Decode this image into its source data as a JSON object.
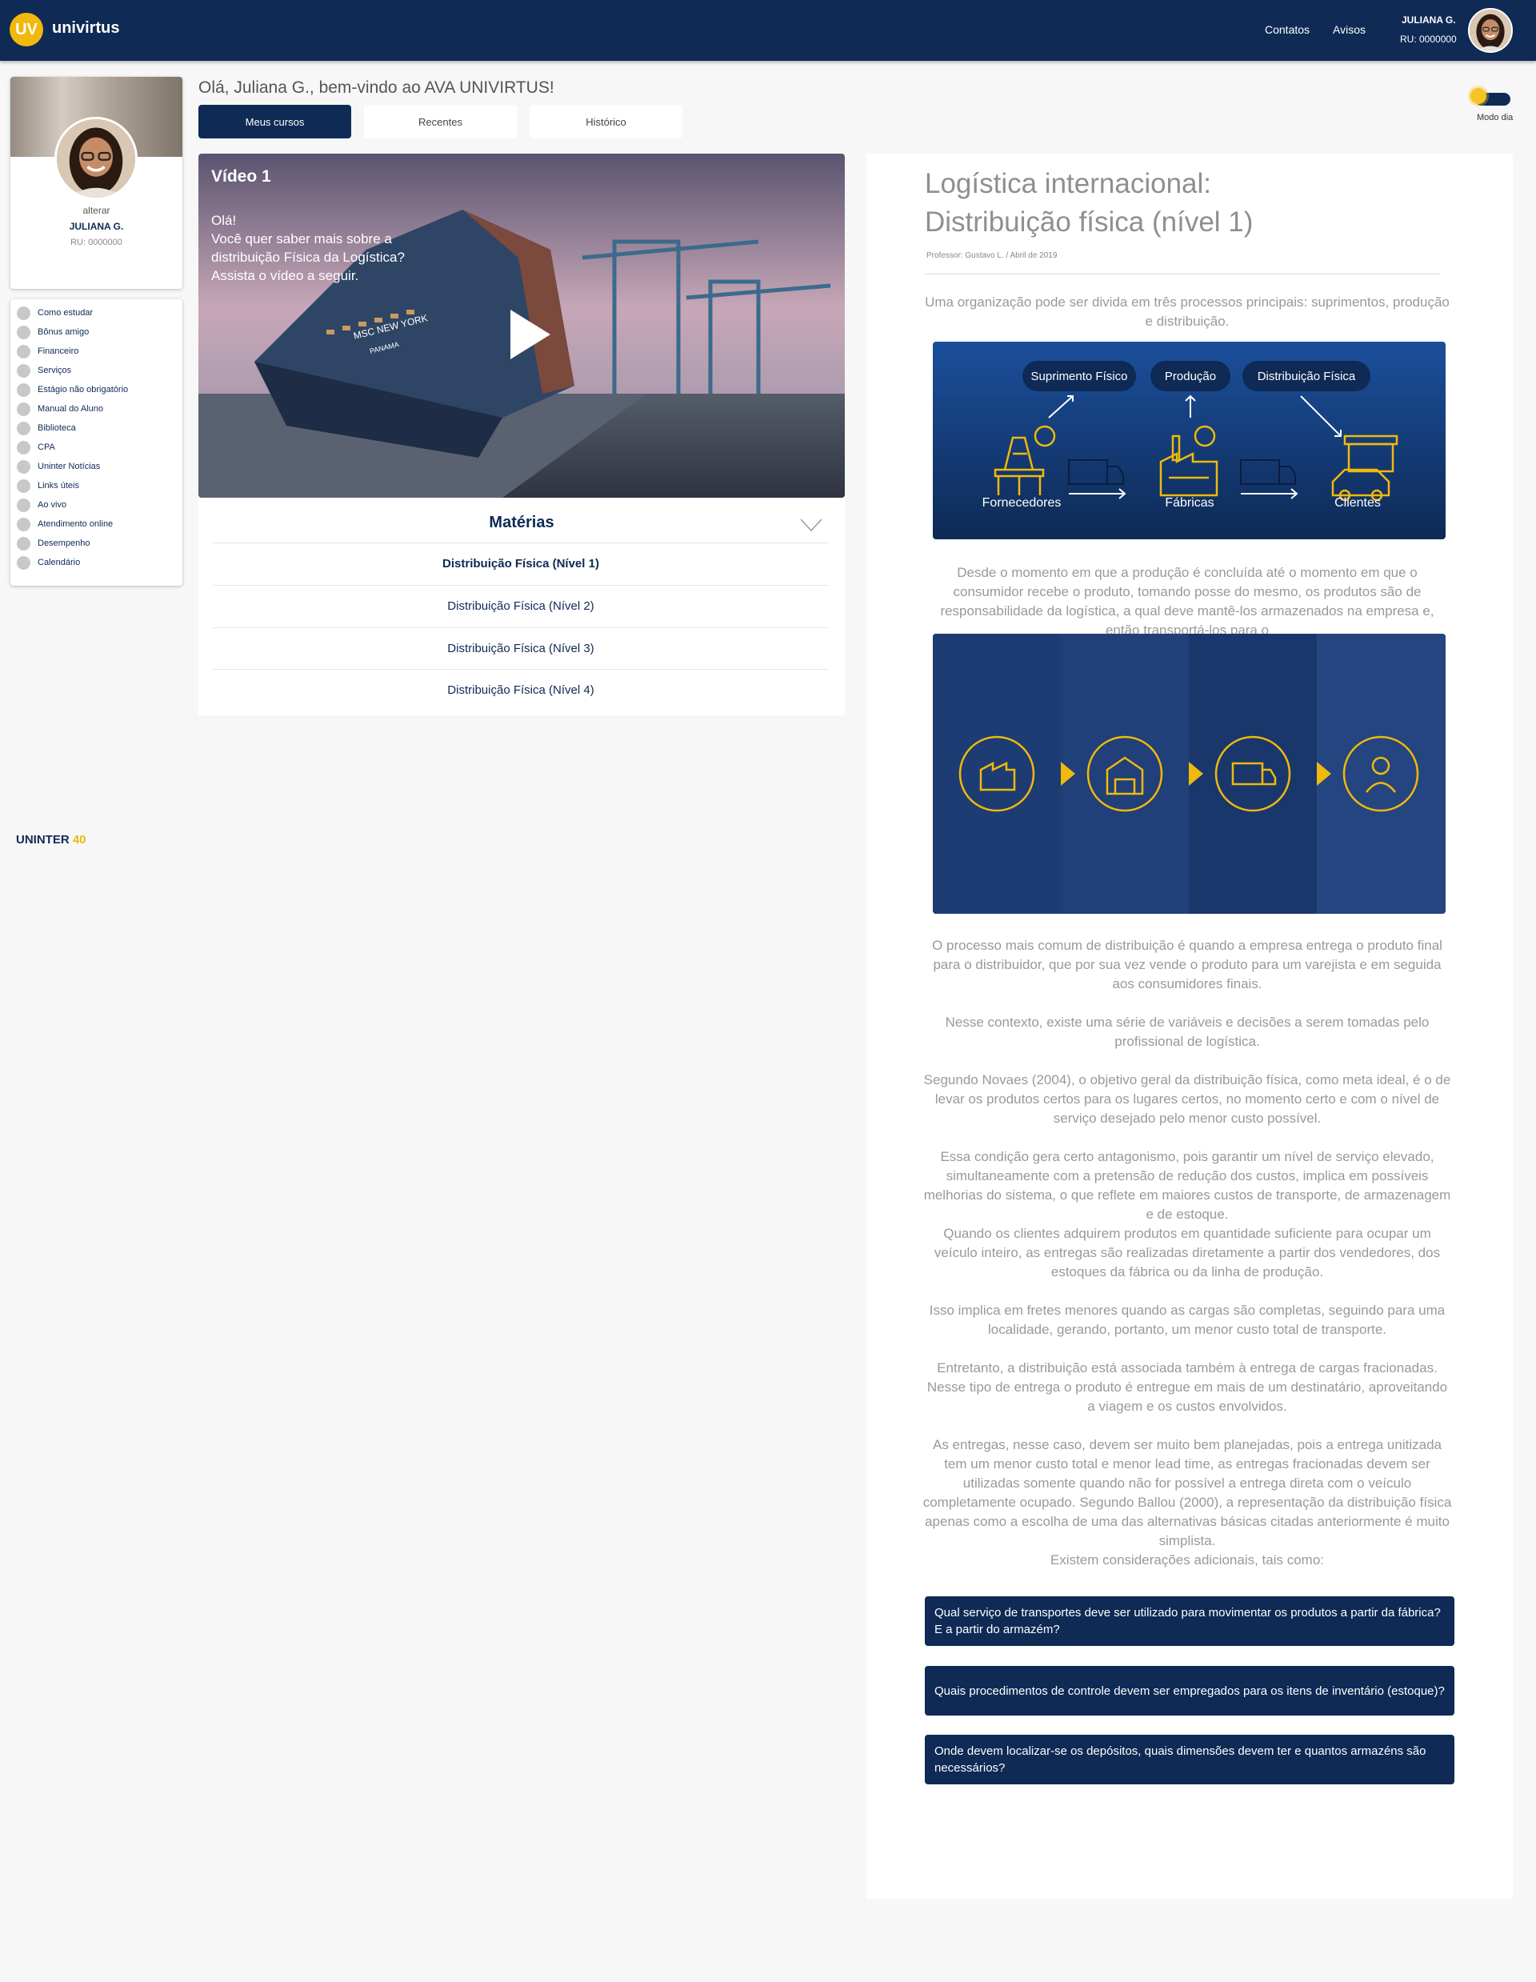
{
  "header": {
    "logo_mark": "UV",
    "logo_text": "univirtus",
    "nav": [
      "Contatos",
      "Avisos"
    ],
    "user_name": "JULIANA G.",
    "user_ru": "RU: 0000000"
  },
  "profile": {
    "alter_label": "alterar",
    "name": "JULIANA G.",
    "ru": "RU: 0000000"
  },
  "sidebar": {
    "items": [
      {
        "label": "Como estudar"
      },
      {
        "label": "Bônus amigo"
      },
      {
        "label": "Financeiro"
      },
      {
        "label": "Serviços"
      },
      {
        "label": "Estágio não obrigatório"
      },
      {
        "label": "Manual do Aluno"
      },
      {
        "label": "Biblioteca"
      },
      {
        "label": "CPA"
      },
      {
        "label": "Uninter Notícias"
      },
      {
        "label": "Links úteis"
      },
      {
        "label": "Ao vivo"
      },
      {
        "label": "Atendimento online"
      },
      {
        "label": "Desempenho"
      },
      {
        "label": "Calendário"
      }
    ],
    "footer_logo": "UNINTER",
    "footer_logo_badge": "40"
  },
  "main": {
    "greeting": "Olá, Juliana G., bem-vindo ao AVA UNIVIRTUS!",
    "tabs": [
      "Meus cursos",
      "Recentes",
      "Histórico"
    ],
    "mode_label": "Modo dia",
    "video": {
      "title": "Vídeo 1",
      "text": "Olá!\nVocê quer saber mais sobre a distribuição Física da Logística?\nAssista o vídeo a seguir.",
      "ship_name": "MSC NEW YORK",
      "ship_port": "PANAMA"
    },
    "materias": {
      "title": "Matérias",
      "items": [
        "Distribuição Física (Nível 1)",
        "Distribuição Física (Nível 2)",
        "Distribuição Física (Nível 3)",
        "Distribuição Física (Nível 4)"
      ]
    }
  },
  "article": {
    "title": "Logística internacional:\nDistribuição física (nível 1)",
    "meta": "Professor: Gustavo L.  /  Abril de 2019",
    "intro": "Uma organização pode ser divida em três processos principais: suprimentos, produção e distribuição.",
    "diagram1": {
      "pills": [
        "Suprimento Físico",
        "Produção",
        "Distribuição Física"
      ],
      "labels": [
        "Fornecedores",
        "Fábricas",
        "Clientes"
      ]
    },
    "paragraph2": "Desde o momento em que a produção é concluída até o momento em que o consumidor recebe o produto, tomando posse do mesmo, os produtos são de responsabilidade da logística, a qual deve mantê-los armazenados na empresa e, então transportá-los para o",
    "paragraphs": [
      "O processo mais comum de distribuição é quando a empresa entrega o produto final para o distribuidor, que por sua vez vende o produto para um varejista e em seguida aos consumidores finais.",
      "Nesse contexto, existe uma série de variáveis e decisões a serem tomadas pelo profissional de logística.",
      "Segundo Novaes (2004), o objetivo geral da distribuição física, como meta ideal, é o de levar os produtos certos para os lugares certos, no momento certo e com o nível de serviço desejado pelo menor custo possível.",
      "Essa condição gera certo antagonismo, pois garantir um nível de serviço elevado, simultaneamente com a pretensão de redução dos custos, implica em possíveis melhorias do sistema, o que reflete em maiores custos de transporte, de armazenagem e de estoque.",
      "Quando os clientes adquirem produtos em quantidade suficiente para ocupar um veículo inteiro, as entregas são realizadas diretamente a partir dos vendedores, dos estoques da fábrica ou da linha de produção.",
      "Isso implica em fretes menores quando as cargas são completas, seguindo para uma localidade, gerando, portanto, um menor custo total de transporte.",
      "Entretanto, a distribuição está associada também à entrega de cargas fracionadas. Nesse tipo de entrega o produto é entregue em mais de um destinatário, aproveitando a viagem e os custos envolvidos.",
      "As entregas, nesse caso, devem ser muito bem planejadas, pois a entrega unitizada tem um menor custo total e menor lead time, as entregas fracionadas devem ser utilizadas somente quando não for possível a entrega direta com o veículo completamente ocupado. Segundo Ballou (2000), a representação da distribuição física apenas como a escolha de uma das alternativas básicas citadas anteriormente é muito simplista.",
      "Existem considerações adicionais, tais como:"
    ],
    "questions": [
      "Qual serviço de transportes deve ser utilizado para movimentar os produtos a partir da fábrica? E a partir do armazém?",
      "Quais procedimentos de controle devem ser empregados para os itens de inventário (estoque)?",
      "Onde devem localizar-se os depósitos, quais dimensões devem ter e quantos armazéns são necessários?"
    ]
  },
  "colors": {
    "brand_navy": "#0e2a55",
    "brand_yellow": "#f0b90b",
    "text_gray": "#999999"
  }
}
